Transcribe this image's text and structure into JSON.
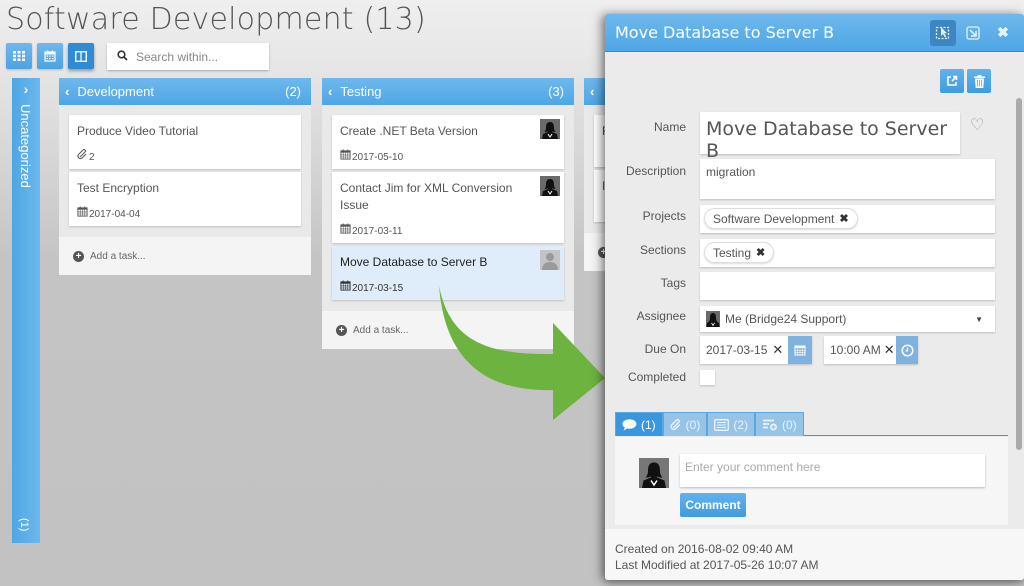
{
  "page": {
    "title": "Software Development (13)"
  },
  "toolbar": {
    "views": [
      {
        "name": "grid-view",
        "icon": "grid-icon"
      },
      {
        "name": "calendar-view",
        "icon": "calendar-icon"
      },
      {
        "name": "board-view",
        "icon": "columns-icon",
        "active": true
      }
    ],
    "search_placeholder": "Search within..."
  },
  "board": {
    "uncategorized": {
      "label": "Uncategorized",
      "count": "(1)"
    },
    "columns": [
      {
        "title": "Development",
        "count": "(2)",
        "cards": [
          {
            "title": "Produce Video Tutorial",
            "meta_icon": "paperclip-icon",
            "meta": "2"
          },
          {
            "title": "Test Encryption",
            "meta_icon": "calendar-icon",
            "meta": "2017-04-04"
          }
        ],
        "add_label": "Add a task..."
      },
      {
        "title": "Testing",
        "count": "(3)",
        "cards": [
          {
            "title": "Create .NET Beta Version",
            "meta_icon": "calendar-icon",
            "meta": "2017-05-10",
            "avatar": "user-avatar"
          },
          {
            "title": "Contact Jim for XML Conversion Issue",
            "meta_icon": "calendar-icon",
            "meta": "2017-03-11",
            "avatar": "user-avatar"
          },
          {
            "title": "Move Database to Server B",
            "meta_icon": "calendar-icon",
            "meta": "2017-03-15",
            "avatar": "placeholder-avatar",
            "selected": true
          }
        ],
        "add_label": "Add a task..."
      },
      {
        "title": "",
        "count": "",
        "cards": [
          {
            "title": "F"
          },
          {
            "title": "I"
          }
        ]
      }
    ]
  },
  "detail": {
    "header_title": "Move Database to Server B",
    "fields": {
      "name_label": "Name",
      "name_value": "Move Database to Server B",
      "description_label": "Description",
      "description_value": "migration",
      "projects_label": "Projects",
      "projects": [
        "Software Development"
      ],
      "sections_label": "Sections",
      "sections": [
        "Testing"
      ],
      "tags_label": "Tags",
      "tags_value": "",
      "assignee_label": "Assignee",
      "assignee_value": "Me (Bridge24 Support)",
      "due_label": "Due On",
      "due_date": "2017-03-15",
      "due_time": "10:00 AM",
      "completed_label": "Completed",
      "completed": false
    },
    "tabs": [
      {
        "icon": "comment-icon",
        "count": "(1)",
        "active": true
      },
      {
        "icon": "paperclip-icon",
        "count": "(0)"
      },
      {
        "icon": "list-icon",
        "count": "(2)"
      },
      {
        "icon": "subtask-icon",
        "count": "(0)"
      }
    ],
    "comment_placeholder": "Enter your comment here",
    "comment_button": "Comment",
    "created": "Created on 2016-08-02 09:40 AM",
    "modified": "Last Modified at 2017-05-26 10:07 AM"
  },
  "colors": {
    "accent": "#4ea6e6",
    "arrow": "#6db33f",
    "selected_card": "#deedf9"
  }
}
